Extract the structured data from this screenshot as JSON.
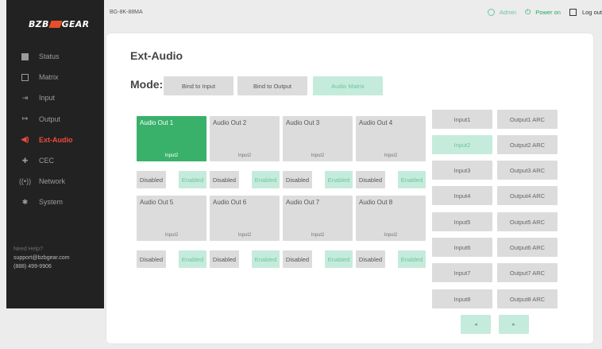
{
  "brand": {
    "left": "BZB",
    "right": "GEAR"
  },
  "device_name": "BG-8K-88MA",
  "topbar": {
    "admin": "Admin",
    "power": "Power on",
    "logout": "Log out"
  },
  "nav": [
    {
      "label": "Status",
      "icon": "status-icon"
    },
    {
      "label": "Matrix",
      "icon": "matrix-icon"
    },
    {
      "label": "Input",
      "icon": "input-icon"
    },
    {
      "label": "Output",
      "icon": "output-icon"
    },
    {
      "label": "Ext-Audio",
      "icon": "audio-icon"
    },
    {
      "label": "CEC",
      "icon": "cec-icon"
    },
    {
      "label": "Network",
      "icon": "network-icon"
    },
    {
      "label": "System",
      "icon": "system-icon"
    }
  ],
  "active_nav": "Ext-Audio",
  "help": {
    "title": "Need Help?",
    "email": "support@bzbgear.com",
    "phone": "(888) 499-9906"
  },
  "page_title": "Ext-Audio",
  "mode": {
    "label": "Mode:",
    "options": [
      "Bind to Input",
      "Bind to Output",
      "Audio Matrix"
    ],
    "selected": "Audio Matrix"
  },
  "audio_outputs": [
    {
      "name": "Audio Out 1",
      "source": "Input2",
      "selected": true
    },
    {
      "name": "Audio Out 2",
      "source": "Input2"
    },
    {
      "name": "Audio Out 3",
      "source": "Input2"
    },
    {
      "name": "Audio Out 4",
      "source": "Input2"
    },
    {
      "name": "Audio Out 5",
      "source": "Input2"
    },
    {
      "name": "Audio Out 6",
      "source": "Input2"
    },
    {
      "name": "Audio Out 7",
      "source": "Input2"
    },
    {
      "name": "Audio Out 8",
      "source": "Input2"
    }
  ],
  "toggle": {
    "disabled": "Disabled",
    "enabled": "Enabled",
    "state": "Enabled"
  },
  "sources": {
    "inputs": [
      "Input1",
      "Input2",
      "Input3",
      "Input4",
      "Input5",
      "Input6",
      "Input7",
      "Input8"
    ],
    "outputs": [
      "Output1 ARC",
      "Output2 ARC",
      "Output3 ARC",
      "Output4 ARC",
      "Output5 ARC",
      "Output6 ARC",
      "Output7 ARC",
      "Output8 ARC"
    ],
    "selected": "Input2"
  },
  "pager": {
    "prev": "◂",
    "next": "▸"
  },
  "colors": {
    "accent": "#39b16b",
    "accent_light": "#c5ebdc",
    "active_nav": "#ef4a3a",
    "sidebar": "#222222"
  }
}
